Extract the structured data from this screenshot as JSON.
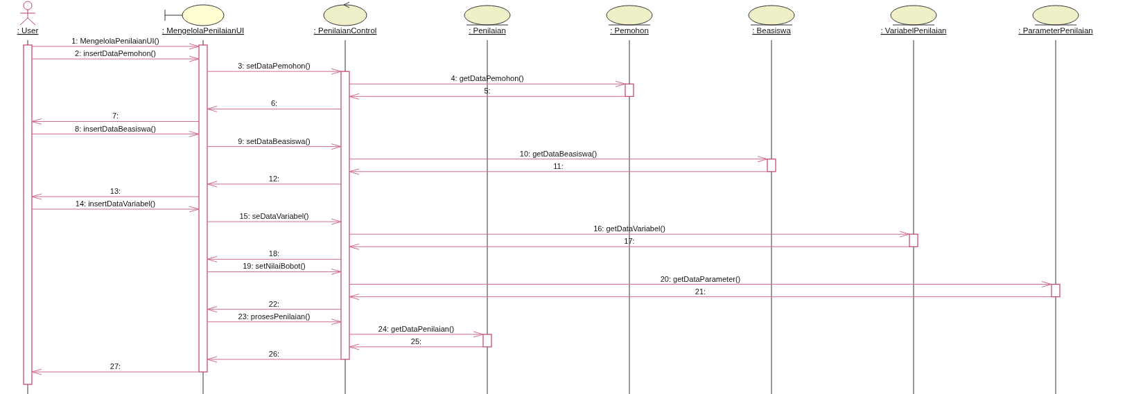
{
  "participants": [
    {
      "name": ": User",
      "kind": "actor"
    },
    {
      "name": ": MengelolaPenilaianUI",
      "kind": "boundary"
    },
    {
      "name": ": PenilaianControl",
      "kind": "control"
    },
    {
      "name": ": Penilaian",
      "kind": "entity"
    },
    {
      "name": ": Pemohon",
      "kind": "entity"
    },
    {
      "name": ": Beasiswa",
      "kind": "entity"
    },
    {
      "name": ": VariabelPenilaian",
      "kind": "entity"
    },
    {
      "name": ": ParameterPenilaian",
      "kind": "entity"
    }
  ],
  "messages": [
    {
      "kind": "user_ui",
      "label": "1: MengelolaPenilaianUI()"
    },
    {
      "kind": "user_ui",
      "label": "2: insertDataPemohon()"
    },
    {
      "kind": "ui_control",
      "label": "3: setDataPemohon()"
    },
    {
      "kind": "control_pemohon",
      "label": "4: getDataPemohon()"
    },
    {
      "kind": "pemohon_control",
      "label": "5:"
    },
    {
      "kind": "control_ui",
      "label": "6:"
    },
    {
      "kind": "ui_user",
      "label": "7:"
    },
    {
      "kind": "user_ui",
      "label": "8: insertDataBeasiswa()"
    },
    {
      "kind": "ui_control",
      "label": "9: setDataBeasiswa()"
    },
    {
      "kind": "control_beasiswa",
      "label": "10: getDataBeasiswa()"
    },
    {
      "kind": "beasiswa_control",
      "label": "11:"
    },
    {
      "kind": "control_ui",
      "label": "12:"
    },
    {
      "kind": "ui_user",
      "label": "13:"
    },
    {
      "kind": "user_ui",
      "label": "14: insertDataVariabel()"
    },
    {
      "kind": "ui_control",
      "label": "15: seDataVariabel()"
    },
    {
      "kind": "control_variabel",
      "label": "16: getDataVariabel()"
    },
    {
      "kind": "variabel_control",
      "label": "17:"
    },
    {
      "kind": "control_ui",
      "label": "18:"
    },
    {
      "kind": "ui_control",
      "label": "19: setNilaiBobot()"
    },
    {
      "kind": "control_parameter",
      "label": "20: getDataParameter()"
    },
    {
      "kind": "parameter_control",
      "label": "21:"
    },
    {
      "kind": "control_ui",
      "label": "22:"
    },
    {
      "kind": "ui_control",
      "label": "23: prosesPenilaian()"
    },
    {
      "kind": "control_penilaian",
      "label": "24: getDataPenilaian()"
    },
    {
      "kind": "penilaian_control",
      "label": "25:"
    },
    {
      "kind": "control_ui",
      "label": "26:"
    },
    {
      "kind": "ui_user",
      "label": "27:"
    }
  ]
}
